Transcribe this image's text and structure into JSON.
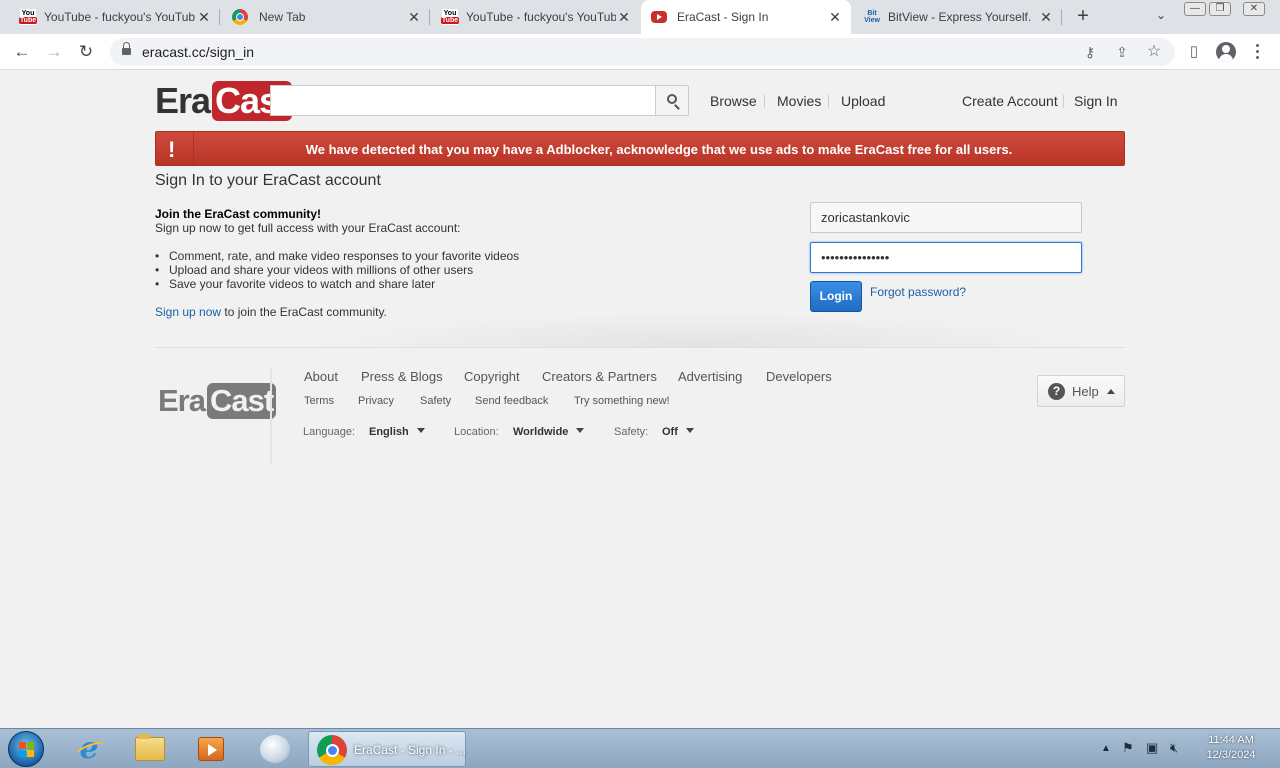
{
  "browser": {
    "tabs": [
      {
        "title": "YouTube - fuckyou's YouTub",
        "icon": "youtube-old-favicon",
        "active": false
      },
      {
        "title": "New Tab",
        "icon": "chrome-favicon",
        "active": false
      },
      {
        "title": "YouTube - fuckyou's YouTub",
        "icon": "youtube-old-favicon",
        "active": false
      },
      {
        "title": "EraCast - Sign In",
        "icon": "youtube-favicon",
        "active": true
      },
      {
        "title": "BitView - Express Yourself.",
        "icon": "bitview-favicon",
        "active": false
      }
    ],
    "url": "eracast.cc/sign_in",
    "fav_old_top": "You",
    "fav_old_bottom": "Tube",
    "fav_bit_top": "Bit",
    "fav_bit_bottom": "View"
  },
  "site": {
    "logo_era": "Era",
    "logo_cast": "Cast",
    "nav": {
      "browse": "Browse",
      "movies": "Movies",
      "upload": "Upload",
      "create_account": "Create Account",
      "sign_in": "Sign In"
    },
    "adblock_message": "We have detected that you may have a Adblocker, acknowledge that we use ads to make EraCast free for all users.",
    "brand_color": "#c0272d"
  },
  "signin": {
    "title": "Sign In to your EraCast account",
    "join_heading": "Join the EraCast community!",
    "join_sub": "Sign up now to get full access with your EraCast account:",
    "benefits": [
      "Comment, rate, and make video responses to your favorite videos",
      "Upload and share your videos with millions of other users",
      "Save your favorite videos to watch and share later"
    ],
    "signup_link": "Sign up now",
    "signup_suffix": " to join the EraCast community.",
    "username_value": "zoricastankovic",
    "password_value": "•••••••••••••••",
    "login_label": "Login",
    "forgot_label": "Forgot password?"
  },
  "footer": {
    "main_links": [
      "About",
      "Press & Blogs",
      "Copyright",
      "Creators & Partners",
      "Advertising",
      "Developers"
    ],
    "sub_links": [
      "Terms",
      "Privacy",
      "Safety",
      "Send feedback",
      "Try something new!"
    ],
    "language_label": "Language:",
    "language_value": "English",
    "location_label": "Location:",
    "location_value": "Worldwide",
    "safety_label": "Safety:",
    "safety_value": "Off",
    "help_label": "Help"
  },
  "taskbar": {
    "active_task": "EraCast - Sign In - ...",
    "time": "11:44 AM",
    "date": "12/3/2024"
  }
}
